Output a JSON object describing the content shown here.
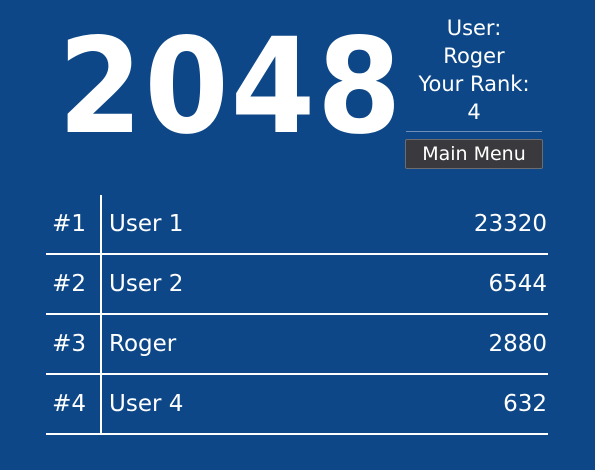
{
  "logo": {
    "text": "2048"
  },
  "user_panel": {
    "user_label": "User:",
    "user_name": "Roger",
    "rank_label": "Your Rank:",
    "rank_value": "4",
    "main_menu_label": "Main Menu"
  },
  "leaderboard": {
    "rows": [
      {
        "rank": "#1",
        "name": "User 1",
        "score": "23320"
      },
      {
        "rank": "#2",
        "name": "User 2",
        "score": "6544"
      },
      {
        "rank": "#3",
        "name": "Roger",
        "score": "2880"
      },
      {
        "rank": "#4",
        "name": "User 4",
        "score": "632"
      }
    ]
  },
  "colors": {
    "background": "#0d4787",
    "text": "#ffffff",
    "button": "#3a3a3e"
  }
}
